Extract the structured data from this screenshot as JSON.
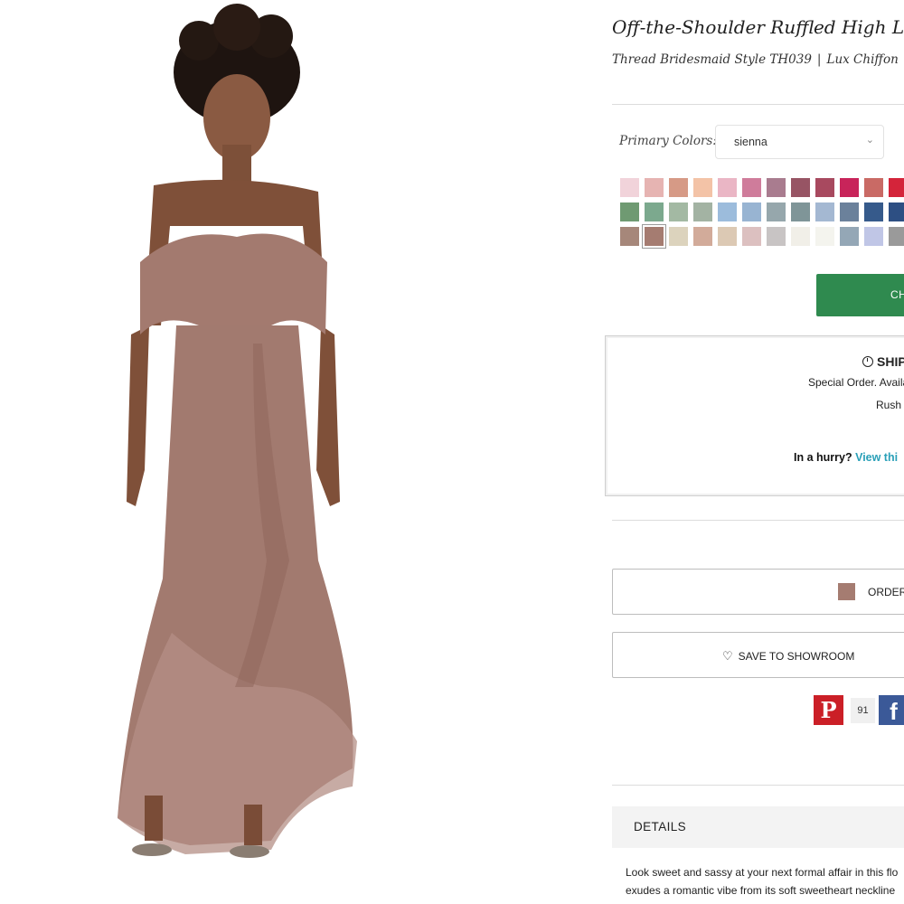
{
  "product": {
    "title": "Off-the-Shoulder Ruffled High Low M",
    "brand_style": "Thread Bridesmaid Style TH039",
    "separator": "|",
    "fabric": "Lux Chiffon",
    "image_icon": "dress-model-photo"
  },
  "colors": {
    "label": "Primary Colors:",
    "selected": "sienna",
    "swatch_rows": [
      [
        "#f1d3da",
        "#e6b4b2",
        "#d69a86",
        "#f3c3a7",
        "#eab6c5",
        "#cf7c9b",
        "#a97c8f",
        "#975464",
        "#a8495f",
        "#c8245a",
        "#c96a65",
        "#d4243a"
      ],
      [
        "#6f9a72",
        "#7ca98e",
        "#a3b9a3",
        "#a3b3a3",
        "#9cbcdc",
        "#98b4d2",
        "#96a7ac",
        "#7f9598",
        "#a4b8d2",
        "#6b819b",
        "#365a8b",
        "#2d4f83"
      ],
      [
        "#a6877a",
        "#a57c71",
        "#dcd3bd",
        "#d2ab9a",
        "#dcc9b4",
        "#dcc0c0",
        "#c8c4c4",
        "#f1efe8",
        "#f4f4ee",
        "#94a7b6",
        "#c0c6e6",
        "#9a9a9a"
      ]
    ],
    "selected_swatch": {
      "row": 2,
      "index": 1
    },
    "dropdown_icon": "chevron-down-icon"
  },
  "cta": {
    "label": "CH",
    "color": "#2f8a4f"
  },
  "shipping": {
    "title": "SHIP",
    "line1": "Special Order. Availa",
    "line2": "Rush c",
    "hurry_prefix": "In a hurry?",
    "hurry_link": "View thi",
    "icon": "clock-icon"
  },
  "order_swatch": {
    "label": "ORDER",
    "color": "#a57c71"
  },
  "save": {
    "label": "SAVE TO SHOWROOM",
    "icon": "heart-icon"
  },
  "social": {
    "pinterest_letter": "P",
    "pin_count": "91",
    "facebook_letter": "f"
  },
  "details": {
    "label": "DETAILS",
    "description_line1": "Look sweet and sassy at your next formal affair in this flo",
    "description_line2": "exudes a romantic vibe from its soft sweetheart neckline"
  }
}
